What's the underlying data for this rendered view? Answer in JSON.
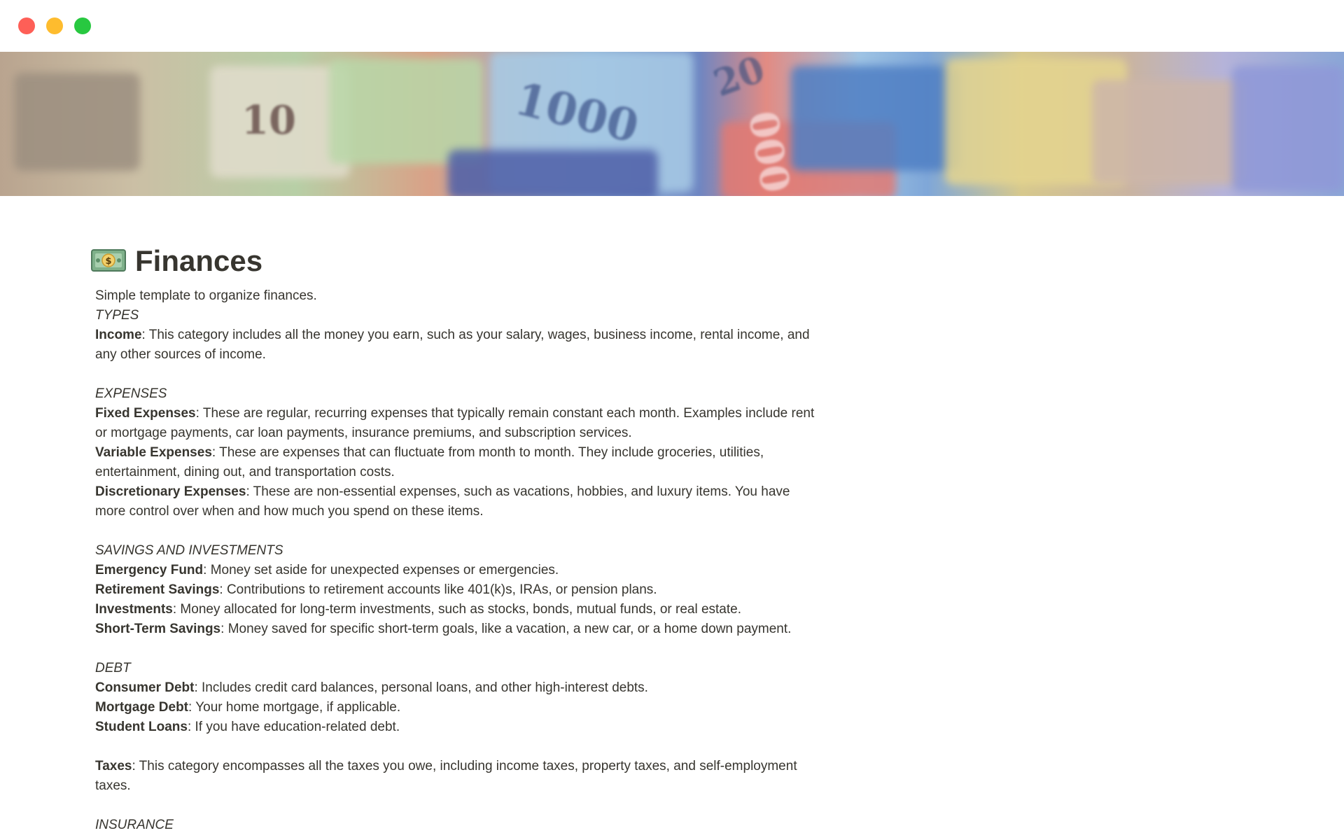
{
  "window": {
    "controls": [
      "close",
      "minimize",
      "maximize"
    ],
    "colors": {
      "close": "#fe5f57",
      "minimize": "#febc2e",
      "maximize": "#28c840"
    }
  },
  "cover": {
    "icon": "banknotes-cover-image"
  },
  "page": {
    "icon": "dollar-banknote-icon",
    "title": "Finances",
    "description": "Simple template to organize finances.",
    "types_heading": "TYPES",
    "income": {
      "term": "Income",
      "text": ": This category includes all the money you earn, such as your salary, wages, business income, rental income, and any other sources of income."
    },
    "expenses_heading": "EXPENSES",
    "expenses": [
      {
        "term": "Fixed Expenses",
        "text": ": These are regular, recurring expenses that typically remain constant each month. Examples include rent or mortgage payments, car loan payments, insurance premiums, and subscription services."
      },
      {
        "term": "Variable Expenses",
        "text": ": These are expenses that can fluctuate from month to month. They include groceries, utilities, entertainment, dining out, and transportation costs."
      },
      {
        "term": "Discretionary Expenses",
        "text": ": These are non-essential expenses, such as vacations, hobbies, and luxury items. You have more control over when and how much you spend on these items."
      }
    ],
    "savings_heading": "SAVINGS AND INVESTMENTS",
    "savings": [
      {
        "term": "Emergency Fund",
        "text": ": Money set aside for unexpected expenses or emergencies."
      },
      {
        "term": "Retirement Savings",
        "text": ": Contributions to retirement accounts like 401(k)s, IRAs, or pension plans."
      },
      {
        "term": "Investments",
        "text": ": Money allocated for long-term investments, such as stocks, bonds, mutual funds, or real estate."
      },
      {
        "term": "Short-Term Savings",
        "text": ": Money saved for specific short-term goals, like a vacation, a new car, or a home down payment."
      }
    ],
    "debt_heading": "DEBT",
    "debt": [
      {
        "term": "Consumer Debt",
        "text": ": Includes credit card balances, personal loans, and other high-interest debts."
      },
      {
        "term": "Mortgage Debt",
        "text": ": Your home mortgage, if applicable."
      },
      {
        "term": "Student Loans",
        "text": ": If you have education-related debt."
      }
    ],
    "taxes": {
      "term": "Taxes",
      "text": ": This category encompasses all the taxes you owe, including income taxes, property taxes, and self-employment taxes."
    },
    "insurance_heading": "INSURANCE"
  }
}
